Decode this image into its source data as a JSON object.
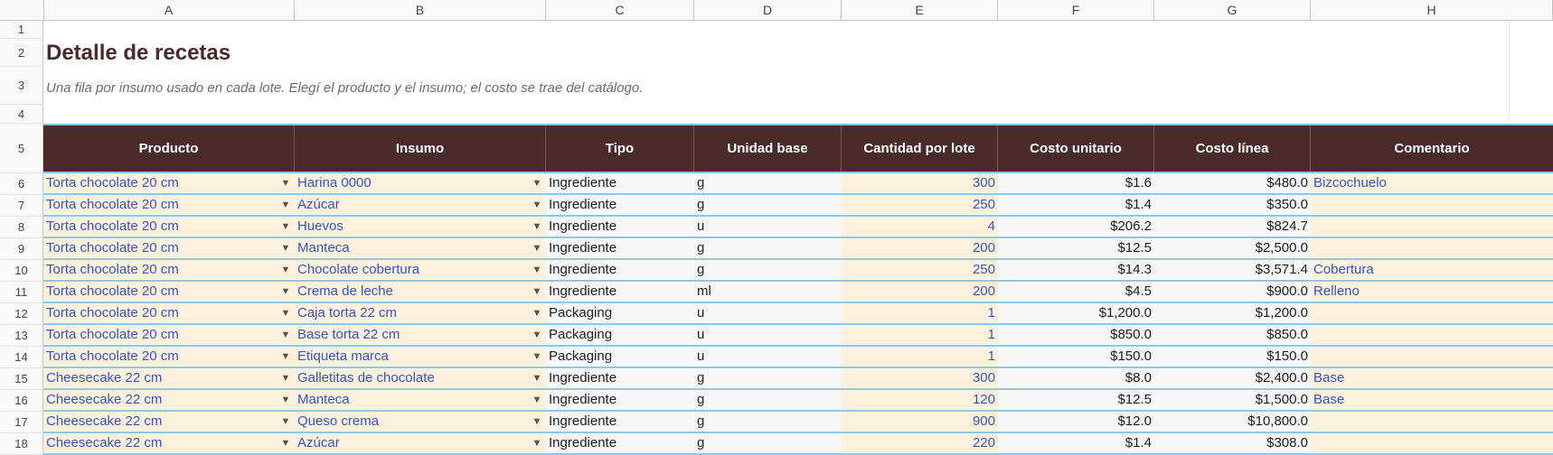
{
  "columns": [
    "A",
    "B",
    "C",
    "D",
    "E",
    "F",
    "G",
    "H"
  ],
  "row_numbers": [
    "1",
    "2",
    "3",
    "4",
    "5",
    "6",
    "7",
    "8",
    "9",
    "10",
    "11",
    "12",
    "13",
    "14",
    "15",
    "16",
    "17",
    "18"
  ],
  "title": "Detalle de recetas",
  "subtitle": "Una fila por insumo usado en cada lote. Elegí el producto y el insumo; el costo se trae del catálogo.",
  "headers": [
    "Producto",
    "Insumo",
    "Tipo",
    "Unidad base",
    "Cantidad por lote",
    "Costo unitario",
    "Costo línea",
    "Comentario"
  ],
  "dropdown_icon": "triangle-down-icon",
  "colors": {
    "header_bg": "#4a2a2a",
    "input_bg": "#fdf0dc",
    "input_text": "#2c56c9",
    "row_border": "#8cc9ea"
  },
  "rows": [
    {
      "producto": "Torta chocolate 20 cm",
      "insumo": "Harina 0000",
      "tipo": "Ingrediente",
      "unidad": "g",
      "cantidad": "300",
      "costo_unitario": "$1.6",
      "costo_linea": "$480.0",
      "comentario": "Bizcochuelo"
    },
    {
      "producto": "Torta chocolate 20 cm",
      "insumo": "Azúcar",
      "tipo": "Ingrediente",
      "unidad": "g",
      "cantidad": "250",
      "costo_unitario": "$1.4",
      "costo_linea": "$350.0",
      "comentario": ""
    },
    {
      "producto": "Torta chocolate 20 cm",
      "insumo": "Huevos",
      "tipo": "Ingrediente",
      "unidad": "u",
      "cantidad": "4",
      "costo_unitario": "$206.2",
      "costo_linea": "$824.7",
      "comentario": ""
    },
    {
      "producto": "Torta chocolate 20 cm",
      "insumo": "Manteca",
      "tipo": "Ingrediente",
      "unidad": "g",
      "cantidad": "200",
      "costo_unitario": "$12.5",
      "costo_linea": "$2,500.0",
      "comentario": ""
    },
    {
      "producto": "Torta chocolate 20 cm",
      "insumo": "Chocolate cobertura",
      "tipo": "Ingrediente",
      "unidad": "g",
      "cantidad": "250",
      "costo_unitario": "$14.3",
      "costo_linea": "$3,571.4",
      "comentario": "Cobertura"
    },
    {
      "producto": "Torta chocolate 20 cm",
      "insumo": "Crema de leche",
      "tipo": "Ingrediente",
      "unidad": "ml",
      "cantidad": "200",
      "costo_unitario": "$4.5",
      "costo_linea": "$900.0",
      "comentario": "Relleno"
    },
    {
      "producto": "Torta chocolate 20 cm",
      "insumo": "Caja torta 22 cm",
      "tipo": "Packaging",
      "unidad": "u",
      "cantidad": "1",
      "costo_unitario": "$1,200.0",
      "costo_linea": "$1,200.0",
      "comentario": ""
    },
    {
      "producto": "Torta chocolate 20 cm",
      "insumo": "Base torta 22 cm",
      "tipo": "Packaging",
      "unidad": "u",
      "cantidad": "1",
      "costo_unitario": "$850.0",
      "costo_linea": "$850.0",
      "comentario": ""
    },
    {
      "producto": "Torta chocolate 20 cm",
      "insumo": "Etiqueta marca",
      "tipo": "Packaging",
      "unidad": "u",
      "cantidad": "1",
      "costo_unitario": "$150.0",
      "costo_linea": "$150.0",
      "comentario": ""
    },
    {
      "producto": "Cheesecake 22 cm",
      "insumo": "Galletitas de chocolate",
      "tipo": "Ingrediente",
      "unidad": "g",
      "cantidad": "300",
      "costo_unitario": "$8.0",
      "costo_linea": "$2,400.0",
      "comentario": "Base"
    },
    {
      "producto": "Cheesecake 22 cm",
      "insumo": "Manteca",
      "tipo": "Ingrediente",
      "unidad": "g",
      "cantidad": "120",
      "costo_unitario": "$12.5",
      "costo_linea": "$1,500.0",
      "comentario": "Base"
    },
    {
      "producto": "Cheesecake 22 cm",
      "insumo": "Queso crema",
      "tipo": "Ingrediente",
      "unidad": "g",
      "cantidad": "900",
      "costo_unitario": "$12.0",
      "costo_linea": "$10,800.0",
      "comentario": ""
    },
    {
      "producto": "Cheesecake 22 cm",
      "insumo": "Azúcar",
      "tipo": "Ingrediente",
      "unidad": "g",
      "cantidad": "220",
      "costo_unitario": "$1.4",
      "costo_linea": "$308.0",
      "comentario": ""
    }
  ]
}
